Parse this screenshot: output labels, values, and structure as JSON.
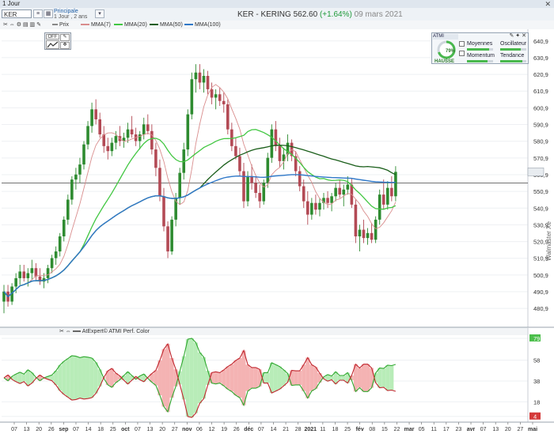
{
  "window": {
    "title": "1 Jour",
    "close_icon": "close-icon"
  },
  "toolbar": {
    "symbol": "KER",
    "template_name": "Principale",
    "template_sub": "1 Jour , 2 ans",
    "title_prefix": "KER - KERING",
    "last_price": "562.60",
    "change": "(+1.64%)",
    "date": "09 mars 2021"
  },
  "legend": {
    "prix": "Prix",
    "mma7": "MMA(7)",
    "mma20": "MMA(20)",
    "mma50": "MMA(50)",
    "mma100": "MMA(100)"
  },
  "tool_panel": {
    "off_label": "OFF"
  },
  "atmi_panel": {
    "header": "ATMI",
    "controls": "✎ ✦ ✕",
    "gauge_pct": "79%",
    "trend_label": "HAUSSE",
    "indicators": [
      {
        "label": "Moyennes",
        "level": 0.85
      },
      {
        "label": "Oscillateur",
        "level": 0.8
      },
      {
        "label": "Momentum",
        "level": 0.8
      },
      {
        "label": "Tendance",
        "level": 0.85
      }
    ]
  },
  "side_label": "Walmaster Xe",
  "sub_header": "AtExpert© ATMI Perf. Color",
  "colors": {
    "up": "#2e8b30",
    "down": "#b34a55",
    "mma7": "#d98d8d",
    "mma20": "#42c742",
    "mma50": "#1a5e1a",
    "mma100": "#2f78c8",
    "green_zone": "#b8ecb8",
    "red_zone": "#f4b3b3"
  },
  "chart_data": {
    "type": "candlestick",
    "price_axis": {
      "ticks": [
        "640,9",
        "630,9",
        "620,9",
        "610,9",
        "600,9",
        "590,9",
        "580,9",
        "570,9",
        "560,9",
        "550,9",
        "540,9",
        "530,9",
        "520,9",
        "510,9",
        "500,9",
        "490,9",
        "480,9"
      ],
      "min": 472,
      "max": 646
    },
    "reference_line": 556,
    "last_value": 562.6,
    "x_ticks": [
      "07",
      "13",
      "20",
      "26",
      "sep",
      "07",
      "14",
      "18",
      "25",
      "oct",
      "07",
      "13",
      "20",
      "27",
      "nov",
      "06",
      "12",
      "19",
      "26",
      "déc",
      "07",
      "14",
      "21",
      "28",
      "2021",
      "11",
      "18",
      "25",
      "fév",
      "08",
      "15",
      "22",
      "mar",
      "05",
      "11",
      "17",
      "23",
      "avr",
      "07",
      "13",
      "20",
      "27",
      "mai"
    ],
    "candles": [
      {
        "o": 485,
        "h": 495,
        "l": 478,
        "c": 491
      },
      {
        "o": 491,
        "h": 495,
        "l": 482,
        "c": 485
      },
      {
        "o": 485,
        "h": 496,
        "l": 483,
        "c": 494
      },
      {
        "o": 494,
        "h": 502,
        "l": 490,
        "c": 499
      },
      {
        "o": 499,
        "h": 507,
        "l": 495,
        "c": 503
      },
      {
        "o": 503,
        "h": 507,
        "l": 497,
        "c": 499
      },
      {
        "o": 499,
        "h": 505,
        "l": 494,
        "c": 502
      },
      {
        "o": 502,
        "h": 510,
        "l": 498,
        "c": 505
      },
      {
        "o": 505,
        "h": 508,
        "l": 498,
        "c": 500
      },
      {
        "o": 500,
        "h": 505,
        "l": 495,
        "c": 497
      },
      {
        "o": 497,
        "h": 502,
        "l": 493,
        "c": 499
      },
      {
        "o": 499,
        "h": 507,
        "l": 496,
        "c": 505
      },
      {
        "o": 505,
        "h": 513,
        "l": 502,
        "c": 511
      },
      {
        "o": 511,
        "h": 518,
        "l": 507,
        "c": 515
      },
      {
        "o": 515,
        "h": 526,
        "l": 512,
        "c": 524
      },
      {
        "o": 524,
        "h": 536,
        "l": 521,
        "c": 534
      },
      {
        "o": 534,
        "h": 549,
        "l": 531,
        "c": 546
      },
      {
        "o": 546,
        "h": 560,
        "l": 543,
        "c": 558
      },
      {
        "o": 558,
        "h": 565,
        "l": 552,
        "c": 561
      },
      {
        "o": 561,
        "h": 571,
        "l": 556,
        "c": 567
      },
      {
        "o": 567,
        "h": 581,
        "l": 564,
        "c": 579
      },
      {
        "o": 579,
        "h": 593,
        "l": 576,
        "c": 590
      },
      {
        "o": 590,
        "h": 604,
        "l": 586,
        "c": 600
      },
      {
        "o": 600,
        "h": 606,
        "l": 591,
        "c": 594
      },
      {
        "o": 594,
        "h": 598,
        "l": 583,
        "c": 585
      },
      {
        "o": 585,
        "h": 590,
        "l": 574,
        "c": 578
      },
      {
        "o": 578,
        "h": 583,
        "l": 570,
        "c": 575
      },
      {
        "o": 575,
        "h": 583,
        "l": 572,
        "c": 580
      },
      {
        "o": 580,
        "h": 587,
        "l": 576,
        "c": 584
      },
      {
        "o": 584,
        "h": 590,
        "l": 578,
        "c": 581
      },
      {
        "o": 581,
        "h": 586,
        "l": 577,
        "c": 583
      },
      {
        "o": 583,
        "h": 592,
        "l": 580,
        "c": 588
      },
      {
        "o": 588,
        "h": 596,
        "l": 583,
        "c": 585
      },
      {
        "o": 585,
        "h": 589,
        "l": 578,
        "c": 581
      },
      {
        "o": 581,
        "h": 587,
        "l": 576,
        "c": 585
      },
      {
        "o": 585,
        "h": 595,
        "l": 582,
        "c": 591
      },
      {
        "o": 591,
        "h": 597,
        "l": 585,
        "c": 587
      },
      {
        "o": 587,
        "h": 591,
        "l": 573,
        "c": 576
      },
      {
        "o": 576,
        "h": 580,
        "l": 560,
        "c": 565
      },
      {
        "o": 565,
        "h": 570,
        "l": 545,
        "c": 548
      },
      {
        "o": 548,
        "h": 553,
        "l": 527,
        "c": 530
      },
      {
        "o": 530,
        "h": 533,
        "l": 511,
        "c": 515
      },
      {
        "o": 515,
        "h": 536,
        "l": 513,
        "c": 534
      },
      {
        "o": 534,
        "h": 550,
        "l": 530,
        "c": 547
      },
      {
        "o": 547,
        "h": 565,
        "l": 543,
        "c": 562
      },
      {
        "o": 562,
        "h": 580,
        "l": 558,
        "c": 576
      },
      {
        "o": 576,
        "h": 600,
        "l": 572,
        "c": 597
      },
      {
        "o": 597,
        "h": 622,
        "l": 594,
        "c": 618
      },
      {
        "o": 618,
        "h": 627,
        "l": 610,
        "c": 622
      },
      {
        "o": 622,
        "h": 627,
        "l": 612,
        "c": 616
      },
      {
        "o": 616,
        "h": 624,
        "l": 610,
        "c": 620
      },
      {
        "o": 620,
        "h": 623,
        "l": 609,
        "c": 612
      },
      {
        "o": 612,
        "h": 616,
        "l": 603,
        "c": 607
      },
      {
        "o": 607,
        "h": 612,
        "l": 600,
        "c": 609
      },
      {
        "o": 609,
        "h": 613,
        "l": 602,
        "c": 605
      },
      {
        "o": 605,
        "h": 610,
        "l": 598,
        "c": 603
      },
      {
        "o": 603,
        "h": 606,
        "l": 585,
        "c": 588
      },
      {
        "o": 588,
        "h": 592,
        "l": 575,
        "c": 578
      },
      {
        "o": 578,
        "h": 583,
        "l": 570,
        "c": 572
      },
      {
        "o": 572,
        "h": 577,
        "l": 560,
        "c": 563
      },
      {
        "o": 563,
        "h": 568,
        "l": 541,
        "c": 545
      },
      {
        "o": 545,
        "h": 563,
        "l": 542,
        "c": 560
      },
      {
        "o": 560,
        "h": 567,
        "l": 552,
        "c": 556
      },
      {
        "o": 556,
        "h": 560,
        "l": 547,
        "c": 550
      },
      {
        "o": 550,
        "h": 555,
        "l": 541,
        "c": 545
      },
      {
        "o": 545,
        "h": 558,
        "l": 543,
        "c": 556
      },
      {
        "o": 556,
        "h": 574,
        "l": 553,
        "c": 571
      },
      {
        "o": 571,
        "h": 591,
        "l": 568,
        "c": 588
      },
      {
        "o": 588,
        "h": 593,
        "l": 575,
        "c": 578
      },
      {
        "o": 578,
        "h": 583,
        "l": 565,
        "c": 569
      },
      {
        "o": 569,
        "h": 577,
        "l": 564,
        "c": 573
      },
      {
        "o": 573,
        "h": 585,
        "l": 569,
        "c": 580
      },
      {
        "o": 580,
        "h": 582,
        "l": 569,
        "c": 572
      },
      {
        "o": 572,
        "h": 575,
        "l": 560,
        "c": 563
      },
      {
        "o": 563,
        "h": 566,
        "l": 551,
        "c": 554
      },
      {
        "o": 554,
        "h": 558,
        "l": 541,
        "c": 545
      },
      {
        "o": 545,
        "h": 551,
        "l": 531,
        "c": 537
      },
      {
        "o": 537,
        "h": 547,
        "l": 534,
        "c": 544
      },
      {
        "o": 544,
        "h": 549,
        "l": 537,
        "c": 540
      },
      {
        "o": 540,
        "h": 547,
        "l": 536,
        "c": 544
      },
      {
        "o": 544,
        "h": 550,
        "l": 540,
        "c": 547
      },
      {
        "o": 547,
        "h": 551,
        "l": 541,
        "c": 544
      },
      {
        "o": 544,
        "h": 550,
        "l": 539,
        "c": 548
      },
      {
        "o": 548,
        "h": 556,
        "l": 545,
        "c": 553
      },
      {
        "o": 553,
        "h": 558,
        "l": 547,
        "c": 549
      },
      {
        "o": 549,
        "h": 555,
        "l": 542,
        "c": 552
      },
      {
        "o": 552,
        "h": 560,
        "l": 549,
        "c": 555
      },
      {
        "o": 555,
        "h": 559,
        "l": 541,
        "c": 543
      },
      {
        "o": 543,
        "h": 546,
        "l": 520,
        "c": 524
      },
      {
        "o": 524,
        "h": 531,
        "l": 515,
        "c": 528
      },
      {
        "o": 528,
        "h": 534,
        "l": 520,
        "c": 523
      },
      {
        "o": 523,
        "h": 529,
        "l": 519,
        "c": 526
      },
      {
        "o": 526,
        "h": 532,
        "l": 520,
        "c": 522
      },
      {
        "o": 522,
        "h": 536,
        "l": 520,
        "c": 534
      },
      {
        "o": 534,
        "h": 552,
        "l": 531,
        "c": 549
      },
      {
        "o": 549,
        "h": 558,
        "l": 540,
        "c": 543
      },
      {
        "o": 543,
        "h": 557,
        "l": 540,
        "c": 553
      },
      {
        "o": 553,
        "h": 560,
        "l": 545,
        "c": 548
      },
      {
        "o": 548,
        "h": 566,
        "l": 545,
        "c": 562.6
      }
    ],
    "oscillator": {
      "axis_ticks": [
        "79",
        "58",
        "38",
        "18",
        "4"
      ],
      "min": 0,
      "max": 82,
      "green_last": 79,
      "red_last": 4
    }
  }
}
